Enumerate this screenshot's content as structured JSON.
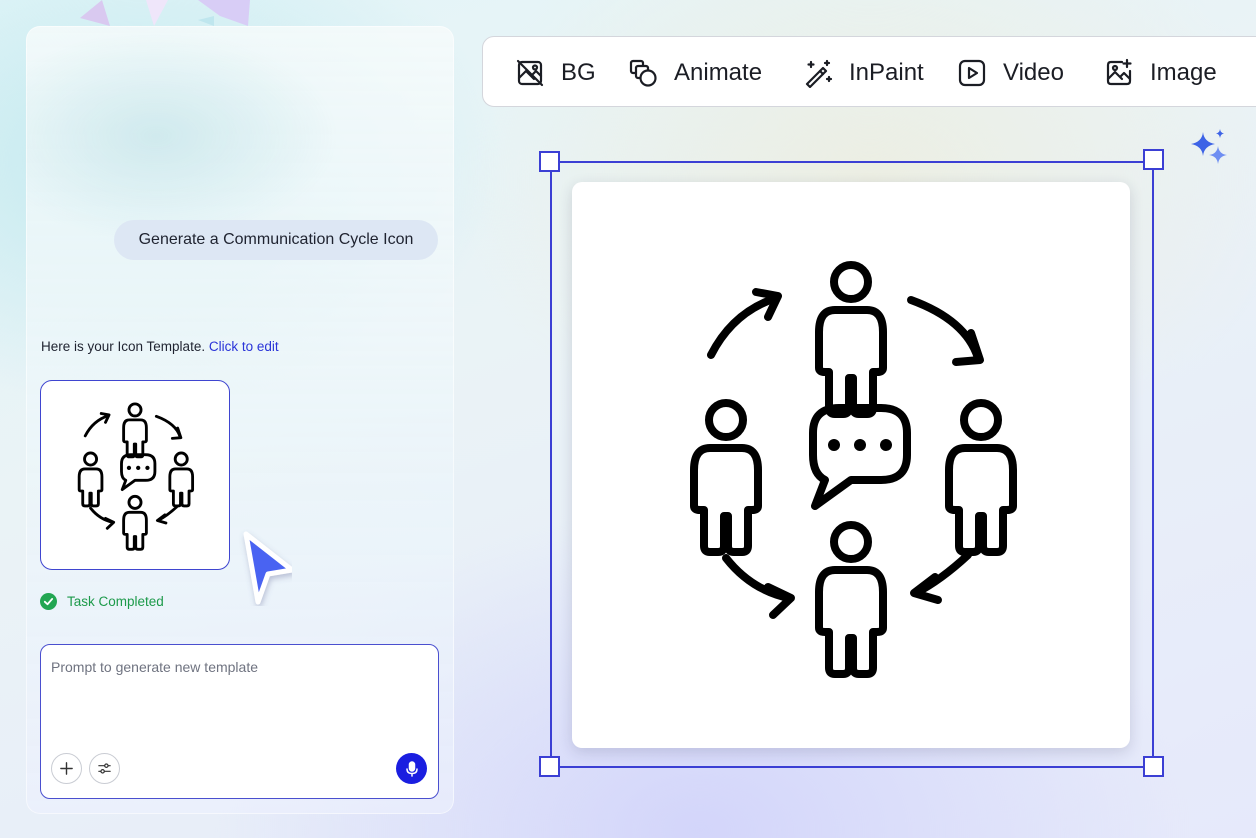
{
  "chat": {
    "user_message": "Generate a Communication Cycle Icon",
    "reply_text": "Here is your Icon Template.",
    "reply_link": "Click to edit",
    "status_text": "Task Completed",
    "prompt_placeholder": "Prompt to generate new template"
  },
  "toolbar": {
    "tools": [
      {
        "label": "BG",
        "icon": "remove-background-icon"
      },
      {
        "label": "Animate",
        "icon": "animate-shapes-icon"
      },
      {
        "label": "InPaint",
        "icon": "magic-wand-icon"
      },
      {
        "label": "Video",
        "icon": "video-play-icon"
      },
      {
        "label": "Image",
        "icon": "add-image-icon"
      }
    ]
  },
  "colors": {
    "accent": "#3b3fd4",
    "success": "#22a652",
    "mic_button": "#1a1ee0",
    "pointer": "#4a63f2"
  }
}
